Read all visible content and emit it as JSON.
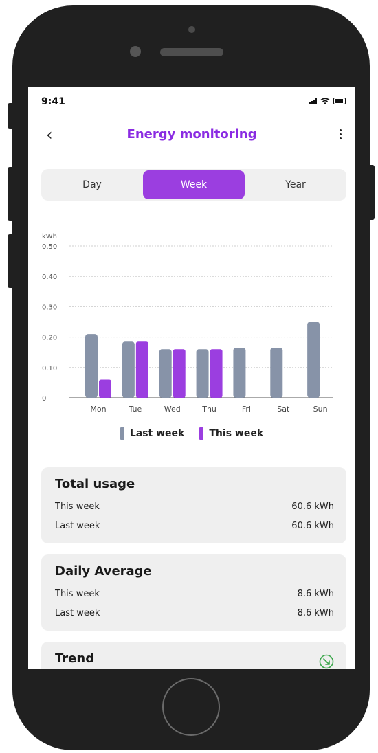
{
  "status": {
    "time": "9:41"
  },
  "header": {
    "title": "Energy monitoring"
  },
  "tabs": [
    {
      "label": "Day",
      "selected": false
    },
    {
      "label": "Week",
      "selected": true
    },
    {
      "label": "Year",
      "selected": false
    }
  ],
  "chart_data": {
    "type": "bar",
    "ylabel": "kWh",
    "ylim": [
      0,
      0.5
    ],
    "yticks": [
      "0.50",
      "0.40",
      "0.30",
      "0.20",
      "0.10",
      "0"
    ],
    "categories": [
      "Mon",
      "Tue",
      "Wed",
      "Thu",
      "Fri",
      "Sat",
      "Sun"
    ],
    "series": [
      {
        "name": "Last week",
        "color": "#8793a8",
        "values": [
          0.21,
          0.185,
          0.16,
          0.16,
          0.165,
          0.165,
          0.25
        ]
      },
      {
        "name": "This week",
        "color": "#9b3ee0",
        "values": [
          0.06,
          0.185,
          0.16,
          0.16,
          null,
          null,
          null
        ]
      }
    ],
    "legend": "bottom",
    "grid": true
  },
  "legend": {
    "last_week": "Last week",
    "this_week": "This week"
  },
  "total_usage": {
    "title": "Total usage",
    "this_week_label": "This week",
    "this_week_value": "60.6 kWh",
    "last_week_label": "Last week",
    "last_week_value": "60.6 kWh"
  },
  "daily_average": {
    "title": "Daily Average",
    "this_week_label": "This week",
    "this_week_value": "8.6 kWh",
    "last_week_label": "Last week",
    "last_week_value": "8.6 kWh"
  },
  "trend": {
    "title": "Trend",
    "icon": "trend-down-icon",
    "icon_color": "#3aa64a"
  }
}
